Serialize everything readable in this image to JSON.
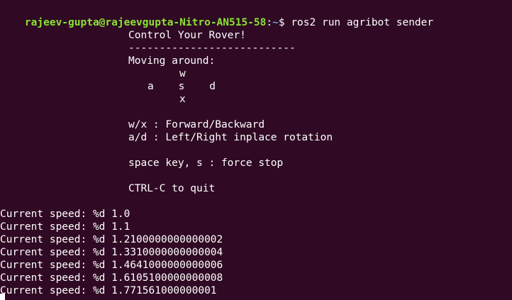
{
  "prompt": {
    "user_host": "rajeev-gupta@rajeevgupta-Nitro-AN515-58",
    "sep": ":",
    "path": "~",
    "symbol": "$ ",
    "command": "ros2 run agribot sender"
  },
  "help": {
    "title": "Control Your Rover!",
    "divider": "---------------------------",
    "moving_label": "Moving around:",
    "key_w": "w",
    "key_row": "a    s    d",
    "key_x": "x",
    "wx_desc": "w/x : Forward/Backward",
    "ad_desc": "a/d : Left/Right inplace rotation",
    "space_desc": "space key, s : force stop",
    "quit_desc": "CTRL-C to quit"
  },
  "speed_lines": [
    "Current speed: %d 1.0",
    "Current speed: %d 1.1",
    "Current speed: %d 1.2100000000000002",
    "Current speed: %d 1.3310000000000004",
    "Current speed: %d 1.4641000000000006",
    "Current speed: %d 1.6105100000000008",
    "Current speed: %d 1.771561000000001"
  ],
  "colors": {
    "background": "#300a24",
    "user_host": "#8ae234",
    "path": "#729fcf",
    "text": "#ffffff"
  }
}
